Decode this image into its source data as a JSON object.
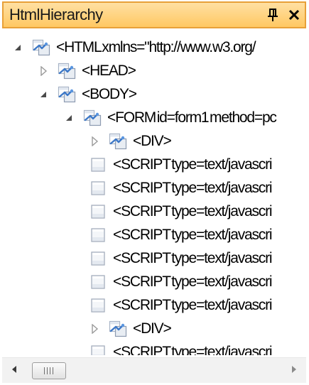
{
  "panel": {
    "title": "HtmlHierarchy"
  },
  "tree": {
    "nodes": [
      {
        "label": "<HTML xmlns=\"http://www.w3.org/",
        "depth": 0,
        "expander": "expanded",
        "icon": "element-folder-icon"
      },
      {
        "label": "<HEAD>",
        "depth": 1,
        "expander": "collapsed",
        "icon": "element-folder-icon"
      },
      {
        "label": "<BODY>",
        "depth": 1,
        "expander": "expanded",
        "icon": "element-folder-icon"
      },
      {
        "label": "<FORM id=form1 method=pc",
        "depth": 2,
        "expander": "expanded",
        "icon": "element-folder-icon"
      },
      {
        "label": "<DIV>",
        "depth": 3,
        "expander": "collapsed",
        "icon": "element-folder-icon"
      },
      {
        "label": "<SCRIPT type=text/javascri",
        "depth": 3,
        "expander": "none",
        "icon": "leaf-element-icon"
      },
      {
        "label": "<SCRIPT type=text/javascri",
        "depth": 3,
        "expander": "none",
        "icon": "leaf-element-icon"
      },
      {
        "label": "<SCRIPT type=text/javascri",
        "depth": 3,
        "expander": "none",
        "icon": "leaf-element-icon"
      },
      {
        "label": "<SCRIPT type=text/javascri",
        "depth": 3,
        "expander": "none",
        "icon": "leaf-element-icon"
      },
      {
        "label": "<SCRIPT type=text/javascri",
        "depth": 3,
        "expander": "none",
        "icon": "leaf-element-icon"
      },
      {
        "label": "<SCRIPT type=text/javascri",
        "depth": 3,
        "expander": "none",
        "icon": "leaf-element-icon"
      },
      {
        "label": "<SCRIPT type=text/javascri",
        "depth": 3,
        "expander": "none",
        "icon": "leaf-element-icon"
      },
      {
        "label": "<DIV>",
        "depth": 3,
        "expander": "collapsed",
        "icon": "element-folder-icon"
      },
      {
        "label": "<SCRIPT type=text/javascri",
        "depth": 3,
        "expander": "none",
        "icon": "leaf-element-icon"
      }
    ]
  },
  "colors": {
    "titlebar_fill": "#ffc862",
    "titlebar_border": "#e8a038",
    "icon_blue": "#3c78c8"
  }
}
